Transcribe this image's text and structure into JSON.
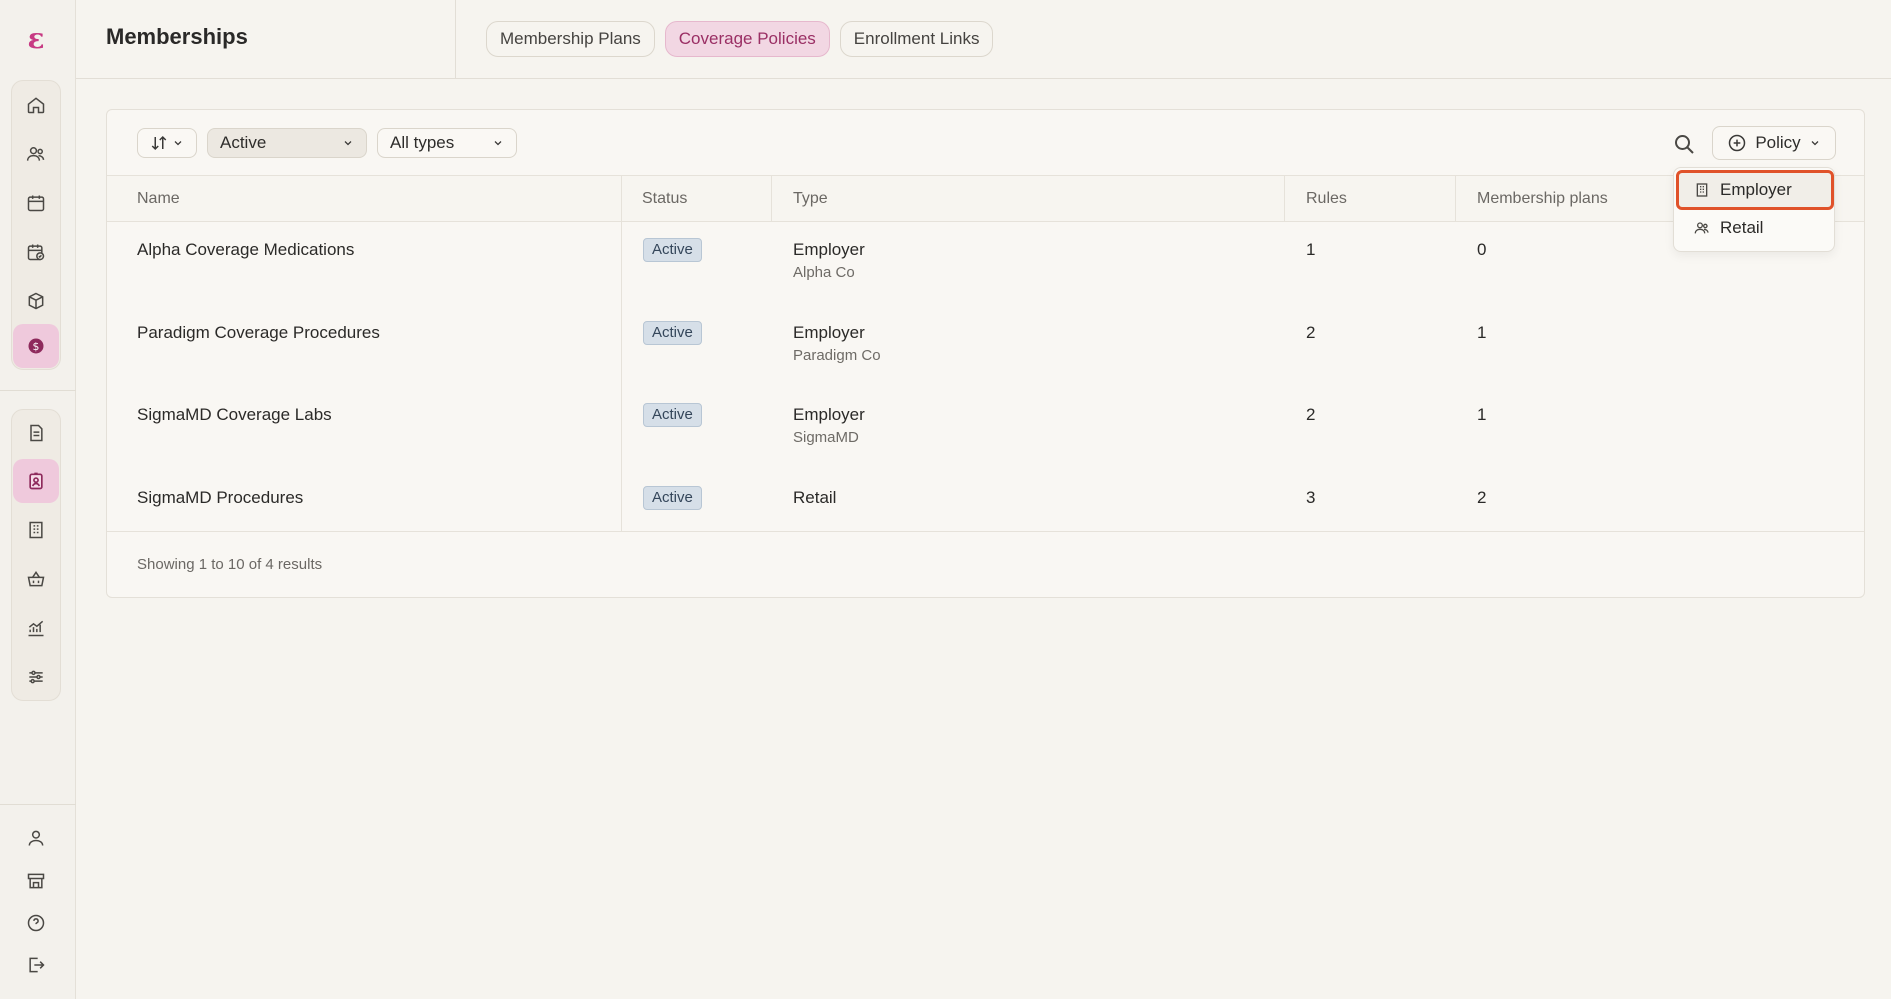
{
  "app": {
    "brand_letter": "ε"
  },
  "header": {
    "title": "Memberships"
  },
  "tabs": [
    {
      "label": "Membership Plans"
    },
    {
      "label": "Coverage Policies"
    },
    {
      "label": "Enrollment Links"
    }
  ],
  "toolbar": {
    "status_filter": "Active",
    "type_filter": "All types",
    "policy_button": "Policy"
  },
  "table": {
    "columns": [
      "Name",
      "Status",
      "Type",
      "Rules",
      "Membership plans"
    ],
    "rows": [
      {
        "name": "Alpha Coverage Medications",
        "status": "Active",
        "type": "Employer",
        "org": "Alpha Co",
        "rules": "1",
        "plans": "0"
      },
      {
        "name": "Paradigm Coverage Procedures",
        "status": "Active",
        "type": "Employer",
        "org": "Paradigm Co",
        "rules": "2",
        "plans": "1"
      },
      {
        "name": "SigmaMD Coverage Labs",
        "status": "Active",
        "type": "Employer",
        "org": "SigmaMD",
        "rules": "2",
        "plans": "1"
      },
      {
        "name": "SigmaMD Procedures",
        "status": "Active",
        "type": "Retail",
        "org": "",
        "rules": "3",
        "plans": "2"
      }
    ],
    "footer": "Showing 1 to 10 of 4 results"
  },
  "dropdown": {
    "items": [
      {
        "label": "Employer",
        "icon": "building-icon"
      },
      {
        "label": "Retail",
        "icon": "users-icon"
      }
    ]
  },
  "colors": {
    "accent": "#c73a83",
    "highlight_border": "#e0522a",
    "badge_bg": "#d6dfe8"
  }
}
